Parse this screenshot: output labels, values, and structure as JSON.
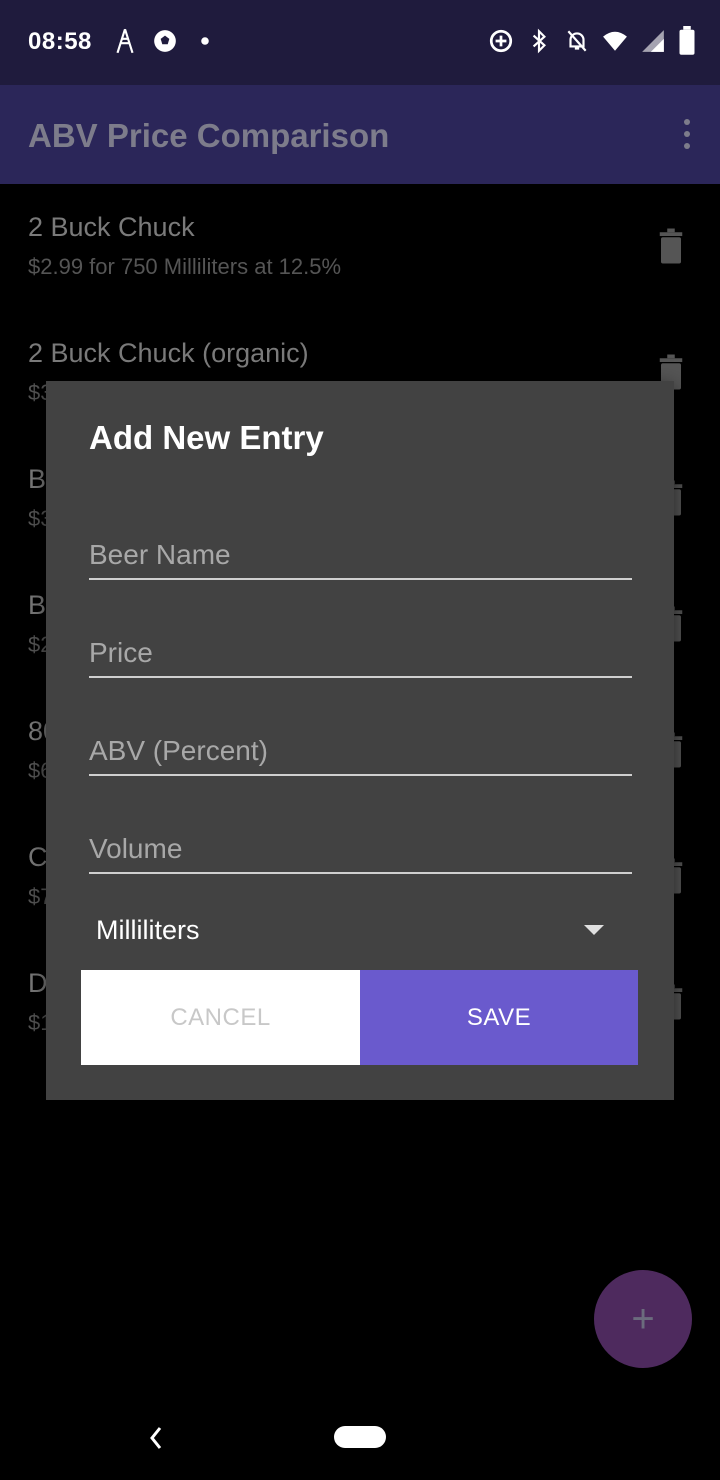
{
  "status_bar": {
    "time": "08:58"
  },
  "app_bar": {
    "title": "ABV Price Comparison"
  },
  "list": [
    {
      "title": "2 Buck Chuck",
      "subtitle": "$2.99 for 750 Milliliters at 12.5%"
    },
    {
      "title": "2 Buck Chuck (organic)",
      "subtitle": "$3"
    },
    {
      "title": "B",
      "subtitle": "$3"
    },
    {
      "title": "B",
      "subtitle": "$2"
    },
    {
      "title": "80",
      "subtitle": "$6"
    },
    {
      "title": "C",
      "subtitle": "$7"
    },
    {
      "title": "D",
      "subtitle": "$1"
    }
  ],
  "dialog": {
    "title": "Add New Entry",
    "fields": {
      "beer_name": {
        "placeholder": "Beer Name",
        "value": ""
      },
      "price": {
        "placeholder": "Price",
        "value": ""
      },
      "abv": {
        "placeholder": "ABV (Percent)",
        "value": ""
      },
      "volume": {
        "placeholder": "Volume",
        "value": ""
      }
    },
    "unit": {
      "selected": "Milliliters"
    },
    "cancel_label": "CANCEL",
    "save_label": "SAVE"
  },
  "fab": {
    "label": "+"
  },
  "colors": {
    "status_bar": "#1f1b3d",
    "app_bar": "#2b2659",
    "dialog_bg": "#424242",
    "save_button": "#6a5acd",
    "fab": "#4e2a5e"
  },
  "icons": [
    "antenna-icon",
    "soccer-ball-icon",
    "notification-dot-icon",
    "data-saver-icon",
    "bluetooth-icon",
    "notifications-off-icon",
    "wifi-icon",
    "cell-signal-icon",
    "battery-icon",
    "more-vert-icon",
    "trash-icon",
    "plus-icon",
    "back-icon",
    "home-icon"
  ]
}
